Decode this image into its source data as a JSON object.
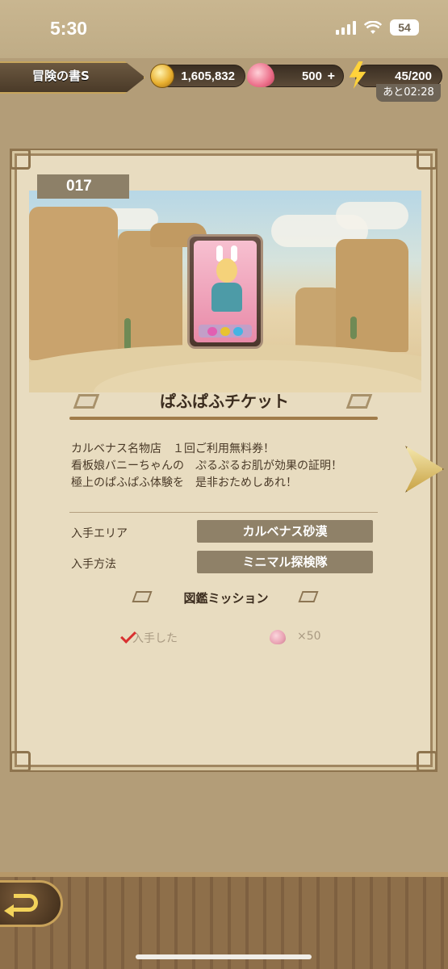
{
  "status_bar": {
    "time": "5:30",
    "battery": "54"
  },
  "hud": {
    "book_name": "冒険の書S",
    "coins": "1,605,832",
    "gems": "500",
    "stamina": "45/200",
    "stamina_timer": "あと02:28",
    "plus_symbol": "+"
  },
  "item": {
    "number": "017",
    "name": "ぱふぱふチケット",
    "description": [
      "カルベナス名物店　１回ご利用無料券！",
      "看板娘バニーちゃんの　ぷるぷるお肌が効果の証明！",
      "極上のぱふぱふ体験を　是非おためしあれ！"
    ],
    "area_label": "入手エリア",
    "area_value": "カルベナス砂漠",
    "method_label": "入手方法",
    "method_value": "ミニマル探検隊"
  },
  "mission": {
    "title": "図鑑ミッション",
    "task": "入手した",
    "reward_count": "×50"
  },
  "colors": {
    "accent": "#d83030",
    "panel": "#e8dcc0",
    "label_box": "#8f8168"
  }
}
